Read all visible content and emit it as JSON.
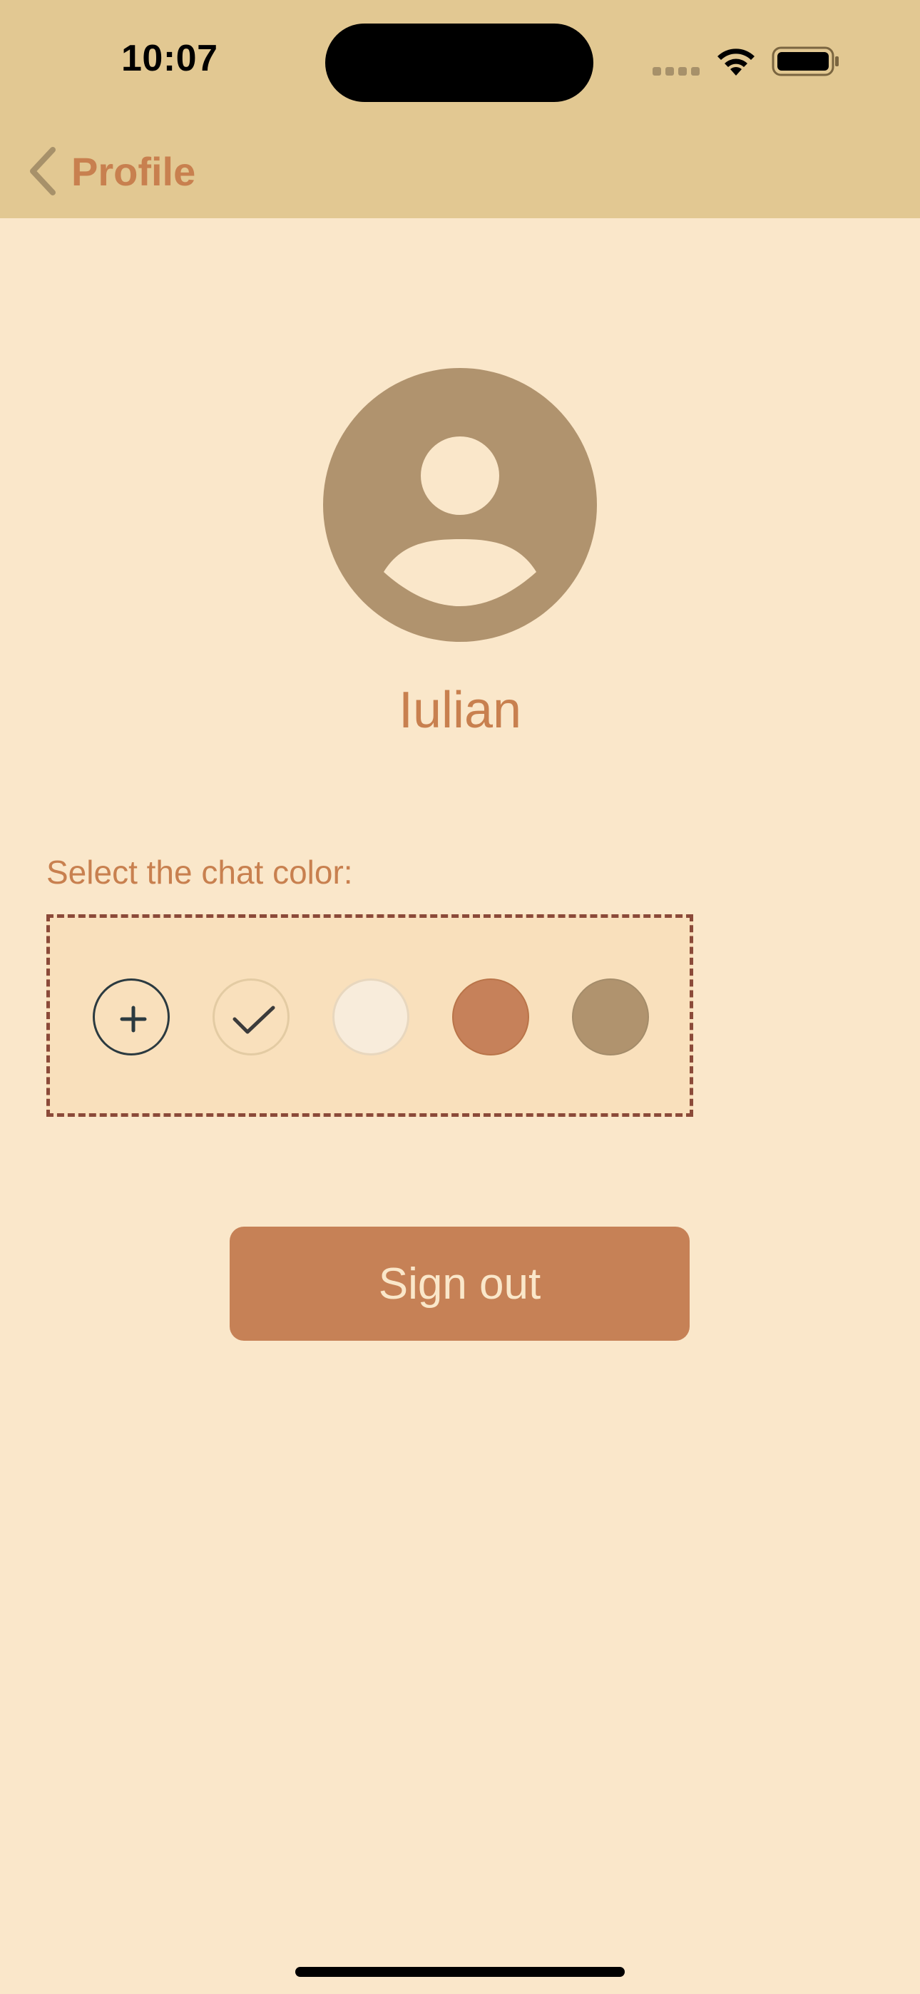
{
  "status_bar": {
    "time": "10:07",
    "icons": [
      "cellular-signal-icon",
      "wifi-icon",
      "battery-icon"
    ]
  },
  "nav": {
    "back_label": "Profile",
    "back_icon": "chevron-left-icon"
  },
  "profile": {
    "avatar_icon": "person-icon",
    "name": "Iulian"
  },
  "chat_color": {
    "label": "Select the chat color:",
    "add_icon": "plus-icon",
    "selected_index": 0,
    "swatches": [
      "#F9E0BC",
      "#F8ECDB",
      "#C6815A",
      "#B0936E"
    ]
  },
  "actions": {
    "sign_out_label": "Sign out"
  },
  "colors": {
    "header_bg": "#E2C892",
    "page_bg": "#FAE7CA",
    "accent": "#C8804F",
    "avatar": "#B0936E",
    "border_dashed": "#8B4A39"
  }
}
